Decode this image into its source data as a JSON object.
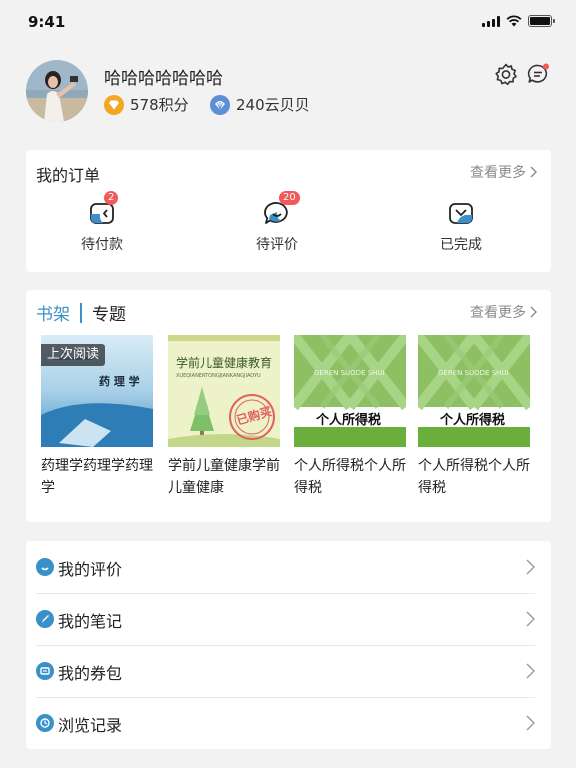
{
  "status_bar": {
    "time": "9:41"
  },
  "profile": {
    "name": "哈哈哈哈哈哈哈",
    "points": "578积分",
    "shells": "240云贝贝"
  },
  "orders": {
    "title": "我的订单",
    "more": "查看更多",
    "items": [
      {
        "label": "待付款",
        "badge": "2"
      },
      {
        "label": "待评价",
        "badge": "20"
      },
      {
        "label": "已完成"
      }
    ]
  },
  "shelf": {
    "tab_active": "书架",
    "tab_other": "专题",
    "more": "查看更多",
    "books": [
      {
        "title": "药理学药理学药理学",
        "cover_title": "药 理 学",
        "tag": "上次阅读"
      },
      {
        "title": "学前儿童健康学前儿童健康",
        "cover_title": "学前儿童健康教育",
        "cover_sub": "XUEQIANERTONGJIANKANGJIAOYU",
        "stamp": "已购买"
      },
      {
        "title": "个人所得税个人所得税",
        "cover_title": "个人所得税",
        "cover_sub": "GEREN SUODE SHUI"
      },
      {
        "title": "个人所得税个人所得税",
        "cover_title": "个人所得税",
        "cover_sub": "GEREN SUODE SHUI"
      }
    ]
  },
  "menu": {
    "items": [
      {
        "label": "我的评价",
        "icon": "comment-icon"
      },
      {
        "label": "我的笔记",
        "icon": "note-icon"
      },
      {
        "label": "我的券包",
        "icon": "coupon-icon"
      },
      {
        "label": "浏览记录",
        "icon": "history-icon"
      }
    ]
  },
  "colors": {
    "accent": "#3a90c9",
    "badge": "#f25a5a",
    "points": "#f5a623",
    "shells": "#5b8fd6"
  }
}
